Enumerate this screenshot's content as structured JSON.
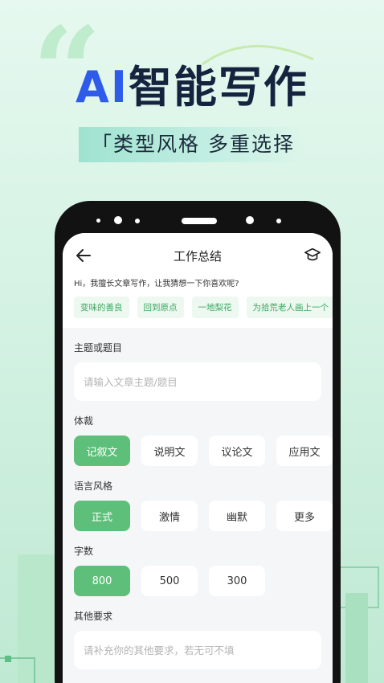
{
  "hero": {
    "title_ai": "AI",
    "title_rest": "智能写作",
    "subtitle": "「类型风格 多重选择"
  },
  "screen": {
    "nav_title": "工作总结",
    "greeting": "Hi，我擅长文章写作，让我猜想一下你喜欢呢?",
    "suggestions": [
      "变味的善良",
      "回到原点",
      "一地梨花",
      "为拾荒老人画上一个"
    ],
    "topic": {
      "label": "主题或题目",
      "placeholder": "请输入文章主题/题目",
      "value": ""
    },
    "genre": {
      "label": "体裁",
      "options": [
        "记叙文",
        "说明文",
        "议论文",
        "应用文"
      ],
      "selected": "记叙文"
    },
    "style": {
      "label": "语言风格",
      "options": [
        "正式",
        "激情",
        "幽默",
        "更多"
      ],
      "selected": "正式"
    },
    "word_count": {
      "label": "字数",
      "options": [
        "800",
        "500",
        "300"
      ],
      "selected": "800"
    },
    "other": {
      "label": "其他要求",
      "placeholder": "请补充你的其他要求，若无可不填",
      "value": ""
    }
  },
  "colors": {
    "accent_green": "#5dbf7a",
    "ai_blue": "#2f5bea",
    "title_dark": "#16233f"
  }
}
